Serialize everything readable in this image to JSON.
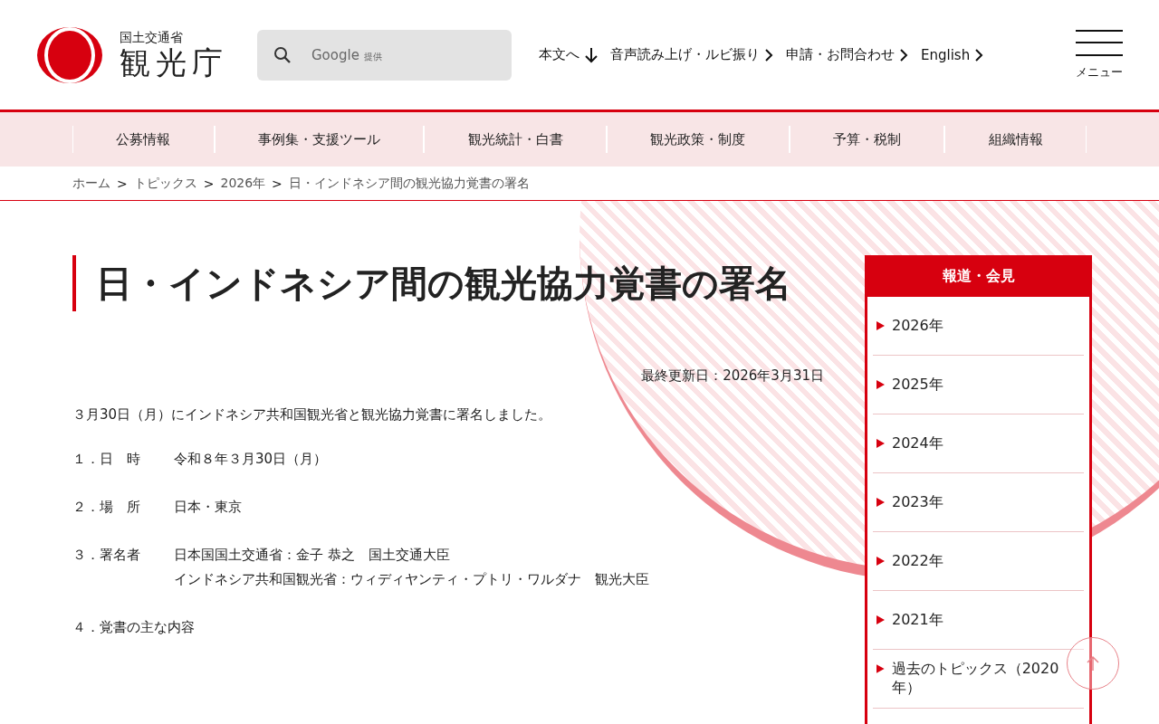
{
  "header": {
    "logo_ministry": "国土交通省",
    "logo_agency": "観光庁",
    "search": {
      "placeholder_brand": "Google",
      "placeholder_note": "提供"
    },
    "links": [
      {
        "label": "本文へ",
        "kind": "skip"
      },
      {
        "label": "音声読み上げ・ルビ振り",
        "kind": "page"
      },
      {
        "label": "申請・お問合わせ",
        "kind": "page"
      },
      {
        "label": "English",
        "kind": "page"
      }
    ],
    "menu_label": "メニュー"
  },
  "nav": [
    "公募情報",
    "事例集・支援ツール",
    "観光統計・白書",
    "観光政策・制度",
    "予算・税制",
    "組織情報"
  ],
  "breadcrumb_separator": ">",
  "breadcrumb": [
    "ホーム",
    "トピックス",
    "2026年",
    "日・インドネシア間の観光協力覚書の署名"
  ],
  "article": {
    "title": "日・インドネシア間の観光協力覚書の署名",
    "updated": "最終更新日：2026年3月31日",
    "lead": "３月30日（月）にインドネシア共和国観光省と観光協力覚書に署名しました。",
    "items": [
      {
        "label": "１．日　時",
        "values": [
          "令和８年３月30日（月）"
        ]
      },
      {
        "label": "２．場　所",
        "values": [
          "日本・東京"
        ]
      },
      {
        "label": "３．署名者",
        "values": [
          "日本国国土交通省：金子 恭之　国土交通大臣",
          "インドネシア共和国観光省：ウィディヤンティ・プトリ・ワルダナ　観光大臣"
        ]
      },
      {
        "label": "４．覚書の主な内容"
      }
    ]
  },
  "sidebar": {
    "title": "報道・会見",
    "items": [
      "2026年",
      "2025年",
      "2024年",
      "2023年",
      "2022年",
      "2021年",
      "過去のトピックス（2020年）"
    ]
  }
}
